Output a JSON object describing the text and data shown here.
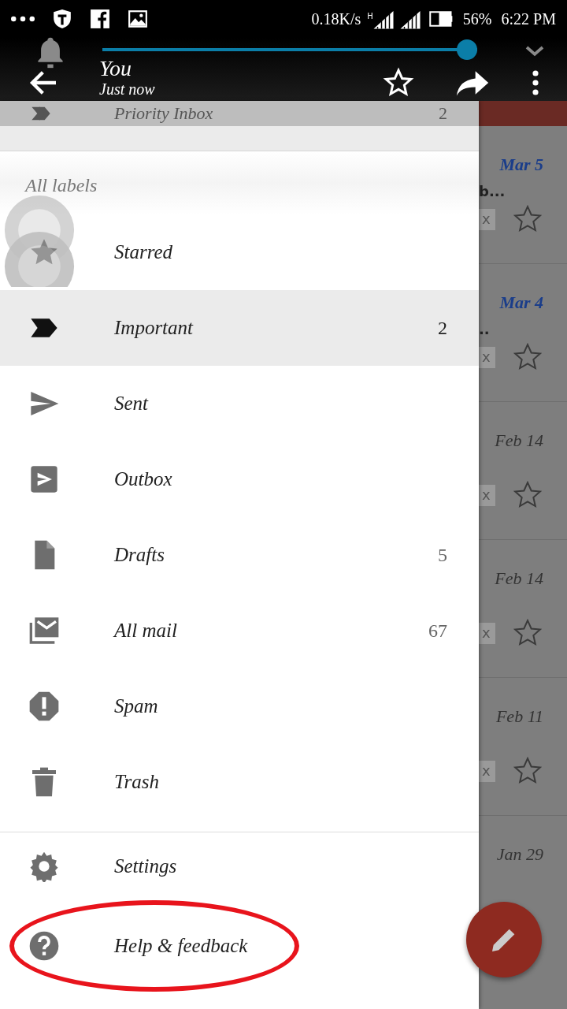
{
  "status_bar": {
    "net_speed": "0.18K/s",
    "network_type": "H",
    "battery": "56%",
    "time": "6:22 PM"
  },
  "media_bar": {
    "level": 1.0
  },
  "header": {
    "title": "You",
    "subtitle": "Just now"
  },
  "drawer": {
    "partial_item": {
      "label": "Priority Inbox",
      "count": "2"
    },
    "section_title": "All labels",
    "items": [
      {
        "kind": "star",
        "label": "Starred",
        "selected": false
      },
      {
        "kind": "important",
        "label": "Important",
        "count": "2",
        "selected": true
      },
      {
        "kind": "sent",
        "label": "Sent",
        "selected": false
      },
      {
        "kind": "outbox",
        "label": "Outbox",
        "selected": false
      },
      {
        "kind": "drafts",
        "label": "Drafts",
        "count": "5",
        "selected": false
      },
      {
        "kind": "allmail",
        "label": "All mail",
        "count": "67",
        "selected": false
      },
      {
        "kind": "spam",
        "label": "Spam",
        "selected": false
      },
      {
        "kind": "trash",
        "label": "Trash",
        "selected": false
      }
    ],
    "footer_items": [
      {
        "kind": "gear",
        "label": "Settings"
      },
      {
        "kind": "help",
        "label": "Help & feedback",
        "circled": true
      }
    ]
  },
  "messages": [
    {
      "date": "Mar 5",
      "unread": true,
      "snippet": "b...",
      "tag": "x"
    },
    {
      "date": "Mar 4",
      "unread": true,
      "snippet": "..",
      "tag": "x"
    },
    {
      "date": "Feb 14",
      "unread": false,
      "tag": "x"
    },
    {
      "date": "Feb 14",
      "unread": false,
      "tag": "x"
    },
    {
      "date": "Feb 11",
      "unread": false,
      "tag": "x"
    },
    {
      "date": "Jan 29",
      "unread": false
    }
  ]
}
